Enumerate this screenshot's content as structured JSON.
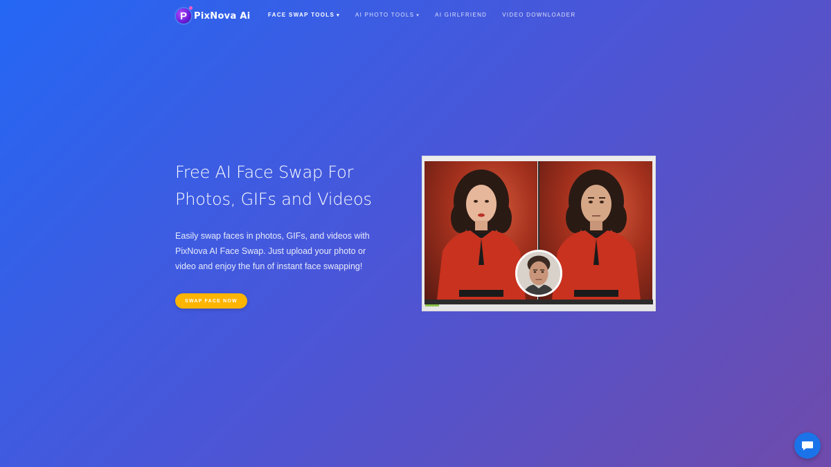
{
  "brand": {
    "logo_letter": "P",
    "name": "PixNova",
    "suffix": "Ai"
  },
  "nav": {
    "items": [
      {
        "label": "FACE SWAP TOOLS",
        "has_dropdown": true,
        "active": true
      },
      {
        "label": "AI PHOTO TOOLS",
        "has_dropdown": true,
        "active": false
      },
      {
        "label": "AI GIRLFRIEND",
        "has_dropdown": false,
        "active": false
      },
      {
        "label": "VIDEO DOWNLOADER",
        "has_dropdown": false,
        "active": false
      }
    ]
  },
  "hero": {
    "title_line1": "Free AI Face Swap For",
    "title_line2": "Photos, GIFs and Videos",
    "description": "Easily swap faces in photos, GIFs, and videos with PixNova AI Face Swap. Just upload your photo or video and enjoy the fun of instant face swapping!",
    "cta_label": "SWAP FACE NOW"
  },
  "colors": {
    "gradient_start": "#2467f4",
    "gradient_end": "#6f4bab",
    "cta": "#ffb400",
    "chat": "#1a73e8"
  },
  "icons": {
    "chat": "chat-bubble-icon",
    "dropdown": "chevron-down-icon"
  }
}
